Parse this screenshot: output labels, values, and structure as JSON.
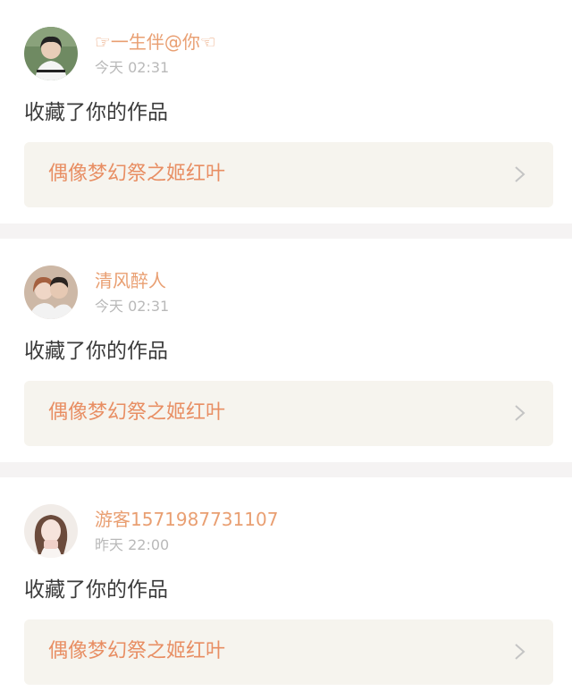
{
  "notifications": [
    {
      "username": "☞一生伴@你☜",
      "time": "今天 02:31",
      "action": "收藏了你的作品",
      "work_title": "偶像梦幻祭之姬红叶",
      "avatar": "boy-avatar"
    },
    {
      "username": "清风醉人",
      "time": "今天 02:31",
      "action": "收藏了你的作品",
      "work_title": "偶像梦幻祭之姬红叶",
      "avatar": "couple-avatar"
    },
    {
      "username": "游客1571987731107",
      "time": "昨天 22:00",
      "action": "收藏了你的作品",
      "work_title": "偶像梦幻祭之姬红叶",
      "avatar": "girl-avatar"
    }
  ],
  "icons": {
    "chevron": "chevron-right-icon"
  },
  "colors": {
    "username": "#e99f72",
    "work_title": "#e88e63",
    "work_background": "#f6f4ee",
    "time": "#b9b9b9",
    "divider": "#f5f3f3"
  }
}
